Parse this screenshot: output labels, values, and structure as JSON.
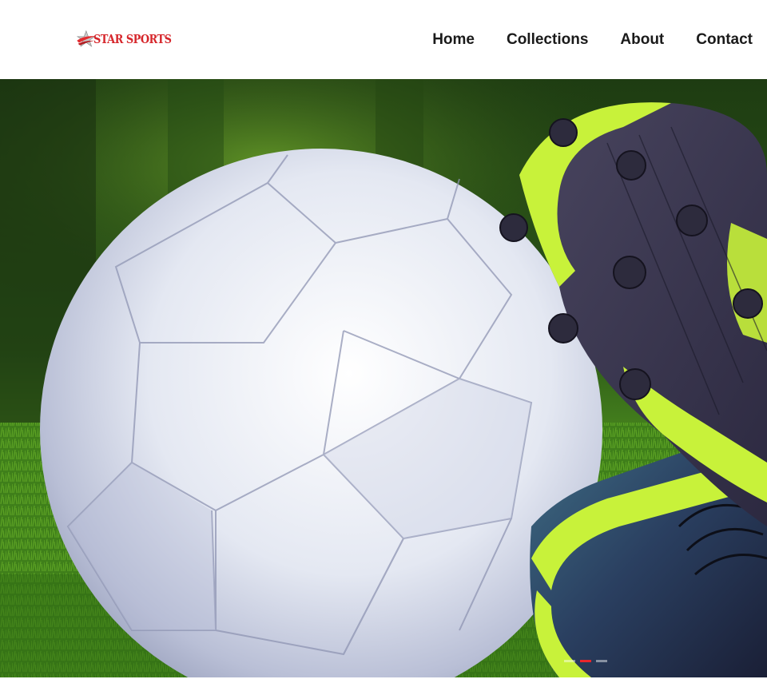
{
  "brand": {
    "name": "STAR SPORTS",
    "accent": "#d6262b"
  },
  "nav": {
    "items": [
      {
        "label": "Home"
      },
      {
        "label": "Collections"
      },
      {
        "label": "About"
      },
      {
        "label": "Contact"
      }
    ]
  },
  "hero": {
    "subject": "soccer-ball-and-cleat-photo",
    "slider": {
      "total": 3,
      "active": 2,
      "active_color": "#e8262b"
    }
  }
}
